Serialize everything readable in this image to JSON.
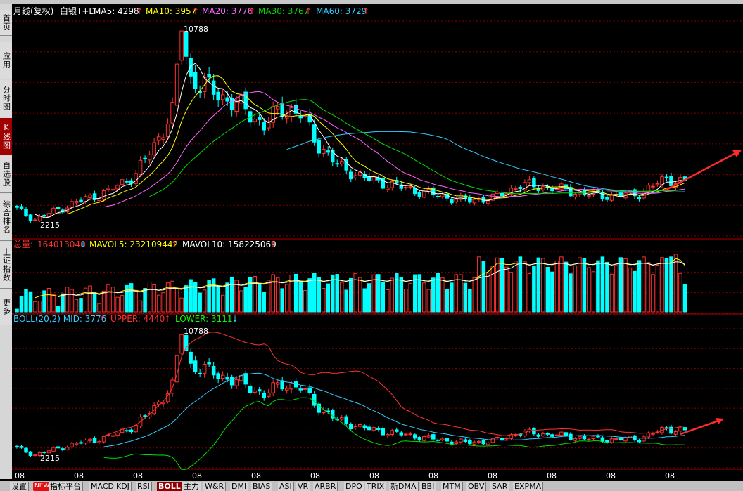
{
  "sidebar": [
    {
      "label": "首页",
      "active": false
    },
    {
      "label": "应用",
      "active": false
    },
    {
      "label": "分时图",
      "active": false
    },
    {
      "label": "K线图",
      "active": true
    },
    {
      "label": "自选股",
      "active": false
    },
    {
      "label": "综合排名",
      "active": false
    },
    {
      "label": "上证指数",
      "active": false
    },
    {
      "label": "更多",
      "active": false
    }
  ],
  "main_panel": {
    "period": "月线(复权)",
    "symbol": "白银T+D",
    "ma": [
      {
        "label": "MA5: 4298",
        "arrow": "↑",
        "color": "#ffffff"
      },
      {
        "label": "MA10: 3957",
        "arrow": "↑",
        "color": "#ffff00"
      },
      {
        "label": "MA20: 3776",
        "arrow": "↑",
        "color": "#ff66ff"
      },
      {
        "label": "MA30: 3767",
        "arrow": "↑",
        "color": "#00dd00"
      },
      {
        "label": "MA60: 3729",
        "arrow": "↑",
        "color": "#33ccff"
      }
    ],
    "high_label": "10788",
    "low_label": "2215"
  },
  "volume_panel": {
    "total": {
      "prefix": "总量: ",
      "value": "164013040",
      "arrow": "↓"
    },
    "mavol5": {
      "label": "MAVOL5: 232109442",
      "arrow": "↑"
    },
    "mavol10": {
      "label": "MAVOL10: 158225069",
      "arrow": "↑"
    }
  },
  "boll_panel": {
    "mid": {
      "label": "BOLL(20,2) MID: 3776",
      "arrow": "↑"
    },
    "upper": {
      "label": "UPPER: 4440",
      "arrow": "↑"
    },
    "lower": {
      "label": "LOWER: 3111",
      "arrow": "↓"
    },
    "high_label": "10788",
    "low_label": "2215"
  },
  "x_tick_labels": [
    "08",
    "08",
    "08",
    "08",
    "08",
    "08",
    "08",
    "08",
    "08",
    "08",
    "08",
    "08"
  ],
  "bottom_tabs": [
    "设置",
    "NEW",
    "指标平台",
    "MACD",
    "KDJ",
    "RSI",
    "BOLL",
    "主力",
    "W&R",
    "DMI",
    "BIAS",
    "ASI",
    "VR",
    "ARBR",
    "DPO",
    "TRIX",
    "新DMA",
    "BBI",
    "MTM",
    "OBV",
    "SAR",
    "EXPMA"
  ],
  "active_tab": "BOLL",
  "colors": {
    "up": "#ff3232",
    "down": "#00ffff",
    "grid": "#8b0000",
    "arrow": "#ff2a2a",
    "label_red": "#ff3232",
    "label_yellow": "#ffff00",
    "label_cyan": "#33ccff",
    "label_white": "#ffffff",
    "label_green": "#00ff00"
  },
  "chart_data": {
    "type": "candlestick",
    "ylim_price": [
      1800,
      11300
    ],
    "close_anchors": [
      [
        0,
        2700
      ],
      [
        4,
        2215
      ],
      [
        8,
        2600
      ],
      [
        14,
        3100
      ],
      [
        20,
        3500
      ],
      [
        26,
        4300
      ],
      [
        30,
        5600
      ],
      [
        34,
        7100
      ],
      [
        36,
        10788
      ],
      [
        38,
        8600
      ],
      [
        41,
        8300
      ],
      [
        45,
        7800
      ],
      [
        50,
        7200
      ],
      [
        54,
        6500
      ],
      [
        58,
        7300
      ],
      [
        62,
        7000
      ],
      [
        66,
        5600
      ],
      [
        70,
        4700
      ],
      [
        76,
        4100
      ],
      [
        84,
        3700
      ],
      [
        92,
        3300
      ],
      [
        98,
        3100
      ],
      [
        104,
        3200
      ],
      [
        110,
        3800
      ],
      [
        116,
        3700
      ],
      [
        124,
        3400
      ],
      [
        130,
        3300
      ],
      [
        136,
        3400
      ],
      [
        142,
        4100
      ],
      [
        146,
        3900
      ]
    ],
    "candle_count": 147,
    "volume_peak": 164013040
  }
}
